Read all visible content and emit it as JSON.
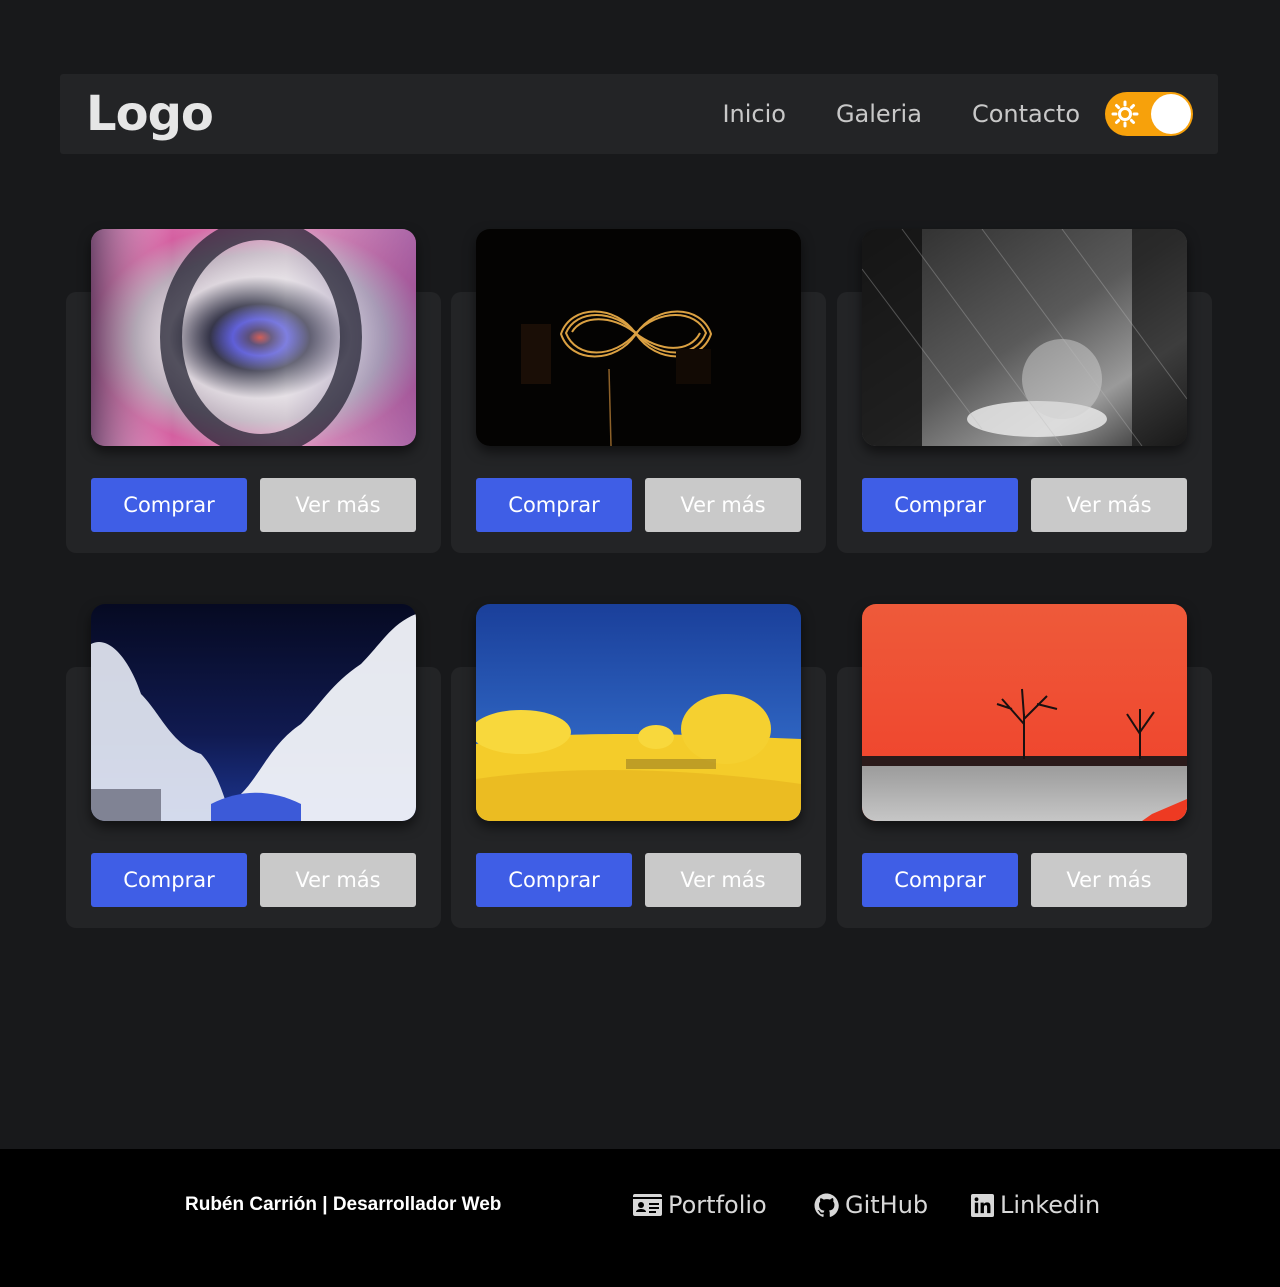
{
  "header": {
    "logo": "Logo",
    "nav": [
      "Inicio",
      "Galeria",
      "Contacto"
    ],
    "theme_toggle": {
      "state": "on",
      "icon": "sun-icon",
      "color": "#f7a10b"
    }
  },
  "gallery": {
    "cards": [
      {
        "image": "blurred-circular-lens",
        "buy_label": "Comprar",
        "more_label": "Ver más"
      },
      {
        "image": "light-infinity-sparkler",
        "buy_label": "Comprar",
        "more_label": "Ver más"
      },
      {
        "image": "bw-motion-forest",
        "buy_label": "Comprar",
        "more_label": "Ver más"
      },
      {
        "image": "infrared-snowy-forest",
        "buy_label": "Comprar",
        "more_label": "Ver más"
      },
      {
        "image": "yellow-field-blue-sky",
        "buy_label": "Comprar",
        "more_label": "Ver más"
      },
      {
        "image": "red-sky-trees",
        "buy_label": "Comprar",
        "more_label": "Ver más"
      }
    ],
    "colors": {
      "buy": "#3f5ee6",
      "more": "#c9c9c9"
    }
  },
  "footer": {
    "credit": "Rubén Carrión | Desarrollador Web",
    "links": [
      {
        "label": "Portfolio",
        "icon": "id-card-icon"
      },
      {
        "label": "GitHub",
        "icon": "github-icon"
      },
      {
        "label": "Linkedin",
        "icon": "linkedin-icon"
      }
    ]
  }
}
